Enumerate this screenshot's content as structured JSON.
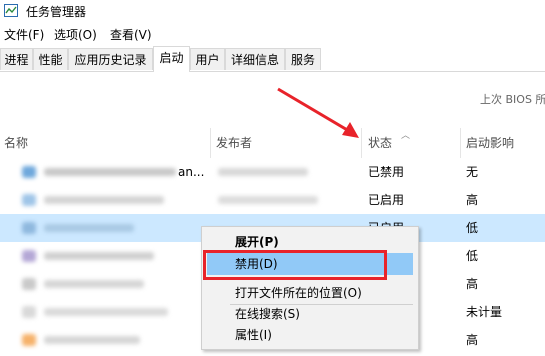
{
  "window": {
    "title": "任务管理器"
  },
  "menu": [
    "文件(F)",
    "选项(O)",
    "查看(V)"
  ],
  "tabs": [
    {
      "label": "进程",
      "active": false
    },
    {
      "label": "性能",
      "active": false
    },
    {
      "label": "应用历史记录",
      "active": false
    },
    {
      "label": "启动",
      "active": true
    },
    {
      "label": "用户",
      "active": false
    },
    {
      "label": "详细信息",
      "active": false
    },
    {
      "label": "服务",
      "active": false
    }
  ],
  "bios_text": "上次 BIOS 所",
  "columns": {
    "name": "名称",
    "publisher": "发布者",
    "status": "状态",
    "impact": "启动影响"
  },
  "rows": [
    {
      "name_visible": "an...",
      "status": "已禁用",
      "impact": "无",
      "selected": false
    },
    {
      "name_visible": "",
      "status": "已启用",
      "impact": "高",
      "selected": false
    },
    {
      "name_visible": "",
      "status": "已启用",
      "impact": "低",
      "selected": true
    },
    {
      "name_visible": "",
      "status": "",
      "impact": "低",
      "selected": false
    },
    {
      "name_visible": "",
      "status": "",
      "impact": "高",
      "selected": false
    },
    {
      "name_visible": "",
      "status": "",
      "impact": "未计量",
      "selected": false
    },
    {
      "name_visible": "",
      "status": "",
      "impact": "高",
      "selected": false
    }
  ],
  "context_menu": {
    "items": [
      {
        "label": "展开(P)",
        "bold": true,
        "highlighted": false
      },
      {
        "label": "禁用(D)",
        "bold": false,
        "highlighted": true
      },
      {
        "label": "打开文件所在的位置(O)",
        "bold": false,
        "highlighted": false
      },
      {
        "label": "在线搜索(S)",
        "bold": false,
        "highlighted": false
      },
      {
        "label": "属性(I)",
        "bold": false,
        "highlighted": false
      }
    ]
  },
  "colors": {
    "selection": "#cce8ff",
    "menu_highlight": "#91c9f7",
    "annotation_red": "#e8232a"
  }
}
